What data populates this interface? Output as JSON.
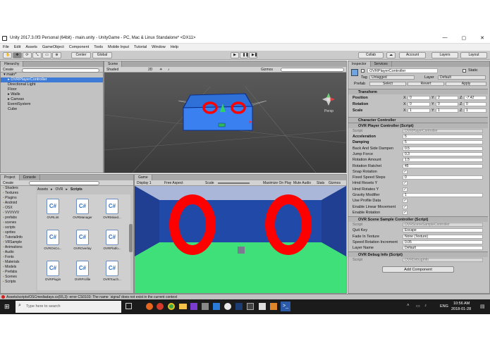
{
  "window": {
    "title": "Unity 2017.3.0f3 Personal (64bit) - main.unity - UnityGame - PC, Mac & Linux Standalone* <DX11>"
  },
  "menu": [
    "File",
    "Edit",
    "Assets",
    "GameObject",
    "Component",
    "Tools",
    "Mobile Input",
    "Tutorial",
    "Window",
    "Help"
  ],
  "toolbar": {
    "center": "Center",
    "global": "Global",
    "collab": "Collab",
    "account": "Account",
    "layers": "Layers",
    "layout": "Layout"
  },
  "hierarchy": {
    "tab": "Hierarchy",
    "create": "Create",
    "search": "All",
    "scene": "main*",
    "items": [
      "OVRPlayerController",
      "Directional Light",
      "Floor",
      "Walls",
      "Canvas",
      "EventSystem",
      "Cube"
    ]
  },
  "scene": {
    "tab": "Scene",
    "shading": "Shaded",
    "mode2d": "2D",
    "gizmos": "Gizmos",
    "search": "All",
    "persp": "Persp"
  },
  "game": {
    "tab": "Game",
    "display": "Display 1",
    "aspect": "Free Aspect",
    "scale": "Scale",
    "maximize": "Maximize On Play",
    "mute": "Mute Audio",
    "stats": "Stats",
    "gizmos": "Gizmos"
  },
  "project": {
    "tabs": [
      "Project",
      "Console"
    ],
    "create": "Create",
    "breadcrumb": [
      "Assets",
      "OVR",
      "Scripts"
    ],
    "tree": [
      "Shaders",
      "Textures",
      "Plugins",
      "Android",
      "OSX",
      "VVVVVV",
      "prefabs",
      "scenes",
      "scripts",
      "sprites",
      "TutorialInfo",
      "VRSample",
      "Animations",
      "Audio",
      "Fonts",
      "Materials",
      "Models",
      "Prefabs",
      "Scenes",
      "Scripts"
    ],
    "assets": [
      "OVRLint",
      "OVRManager",
      "OVRMixed...",
      "OVROnCo...",
      "OVROverlay",
      "OVRPlatfo...",
      "OVRPlugin",
      "OVRProfile",
      "OVRTouch..."
    ]
  },
  "inspector": {
    "tabs": [
      "Inspector",
      "Services"
    ],
    "object_name": "OVRPlayerController",
    "static": "Static",
    "tag_label": "Tag",
    "tag": "Untagged",
    "layer_label": "Layer",
    "layer": "Default",
    "prefab_label": "Prefab",
    "prefab_buttons": [
      "Select",
      "Revert",
      "Apply"
    ],
    "transform": {
      "title": "Transform",
      "rows": [
        {
          "label": "Position",
          "x": "0",
          "y": "2",
          "z": "-7.42"
        },
        {
          "label": "Rotation",
          "x": "0",
          "y": "0",
          "z": "0"
        },
        {
          "label": "Scale",
          "x": "1",
          "y": "1",
          "z": "1"
        }
      ]
    },
    "character_controller": "Character Controller",
    "player_controller": {
      "title": "OVR Player Controller (Script)",
      "script_label": "Script",
      "script": "OVRPlayerController",
      "fields": [
        {
          "label": "Acceleration",
          "value": "5"
        },
        {
          "label": "Damping",
          "value": "5"
        },
        {
          "label": "Back And Side Dampen",
          "value": "0.5"
        },
        {
          "label": "Jump Force",
          "value": "0.3"
        },
        {
          "label": "Rotation Amount",
          "value": "1.5"
        },
        {
          "label": "Rotation Ratchet",
          "value": "45"
        },
        {
          "label": "Snap Rotation",
          "value": "✓"
        },
        {
          "label": "Fixed Speed Steps",
          "value": "0"
        },
        {
          "label": "Hmd Resets Y",
          "value": "✓"
        },
        {
          "label": "Hmd Rotates Y",
          "value": "✓"
        },
        {
          "label": "Gravity Modifier",
          "value": "1"
        },
        {
          "label": "Use Profile Data",
          "value": "✓"
        },
        {
          "label": "Enable Linear Movement",
          "value": "✓"
        },
        {
          "label": "Enable Rotation",
          "value": "✓"
        }
      ]
    },
    "scene_sample": {
      "title": "OVR Scene Sample Controller (Script)",
      "fields": [
        {
          "label": "Script",
          "value": "OVRSceneSampleController"
        },
        {
          "label": "Quit Key",
          "value": "Escape"
        },
        {
          "label": "Fade In Texture",
          "value": "None (Texture)"
        },
        {
          "label": "Speed Rotation Increment",
          "value": "0.05"
        },
        {
          "label": "Layer Name",
          "value": "Default"
        }
      ]
    },
    "debug_info": {
      "title": "OVR Debug Info (Script)",
      "script_label": "Script",
      "script": "OVRDebugInfo"
    },
    "add_component": "Add Component"
  },
  "status": {
    "error": "Assets/scripts/OSCmediadays.cs(55,3): error CS0103: The name `signal' does not exist in the current context"
  },
  "taskbar": {
    "search": "Type here to search",
    "time": "10:56 AM",
    "date": "2018-01-28",
    "lang": "ENG"
  },
  "colors": {
    "selection": "#3d7bd6",
    "sky": "#1e3f86",
    "floor": "#3fe07a",
    "target": "#ff0000"
  }
}
